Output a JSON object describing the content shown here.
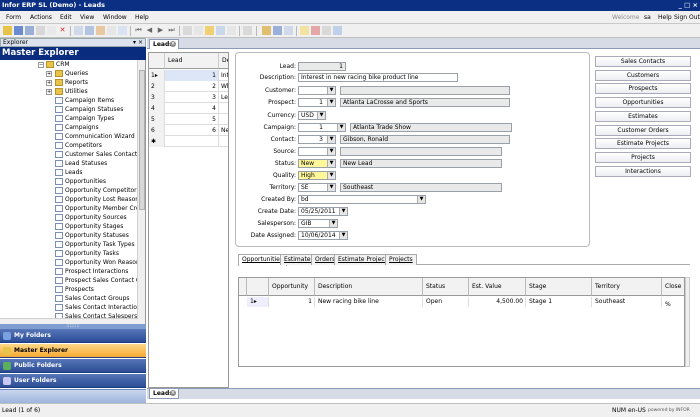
{
  "window": {
    "title": "Infor ERP SL (Demo) - Leads",
    "controls": "_ □ ×"
  },
  "menu": {
    "items": [
      "Form",
      "Actions",
      "Edit",
      "View",
      "Window",
      "Help"
    ],
    "welcome_label": "Welcome",
    "user": "sa",
    "help_label": "Help",
    "signout_label": "Sign Out"
  },
  "explorer": {
    "header": "Explorer",
    "header_controls": "▾ ×",
    "title": "Master Explorer",
    "folders": [
      {
        "label": "CRM",
        "expand": "−"
      },
      {
        "label": "Queries",
        "expand": "+"
      },
      {
        "label": "Reports",
        "expand": "+"
      },
      {
        "label": "Utilities",
        "expand": "+"
      }
    ],
    "items": [
      "Campaign Items",
      "Campaign Statuses",
      "Campaign Types",
      "Campaigns",
      "Communication Wizard",
      "Competitors",
      "Customer Sales Contact Cr",
      "Lead Statuses",
      "Leads",
      "Opportunities",
      "Opportunity Competitor Cr",
      "Opportunity Lost Reasons",
      "Opportunity Member Cross",
      "Opportunity Sources",
      "Opportunity Stages",
      "Opportunity Statuses",
      "Opportunity Task Types",
      "Opportunity Tasks",
      "Opportunity Won Reasons",
      "Prospect Interactions",
      "Prospect Sales Contact Cr",
      "Prospects",
      "Sales Contact Groups",
      "Sales Contact Interactions",
      "Sales Contact Salesperson"
    ],
    "nav": [
      "My Folders",
      "Master Explorer",
      "Public Folders",
      "User Folders"
    ],
    "splitter_grip": "::::::::"
  },
  "tabs": {
    "top": "Leads",
    "bottom": "Leads",
    "close_glyph": "×"
  },
  "grid": {
    "headers": [
      "Lead",
      "De"
    ],
    "rows": [
      {
        "marker": "1▸",
        "lead": "1",
        "desc": "Inte"
      },
      {
        "marker": "2",
        "lead": "2",
        "desc": "Wh"
      },
      {
        "marker": "3",
        "lead": "3",
        "desc": "Lea"
      },
      {
        "marker": "4",
        "lead": "4",
        "desc": ""
      },
      {
        "marker": "5",
        "lead": "5",
        "desc": ""
      },
      {
        "marker": "6",
        "lead": "6",
        "desc": "Ne"
      },
      {
        "marker": "✱",
        "lead": "",
        "desc": ""
      }
    ]
  },
  "form": {
    "lead_label": "Lead:",
    "lead": "1",
    "description_label": "Description:",
    "description": "Interest in new racing bike product line",
    "customer_label": "Customer:",
    "customer": "",
    "prospect_label": "Prospect:",
    "prospect_id": "1",
    "prospect_name": "Atlanta LaCrosse and Sports",
    "currency_label": "Currency:",
    "currency": "USD",
    "campaign_label": "Campaign:",
    "campaign_id": "1",
    "campaign_name": "Atlanta Trade Show",
    "contact_label": "Contact:",
    "contact_id": "3",
    "contact_name": "Gibson, Ronald",
    "source_label": "Source:",
    "source": "",
    "status_label": "Status:",
    "status": "New",
    "status_desc": "New Lead",
    "quality_label": "Quality:",
    "quality": "High",
    "territory_label": "Territory:",
    "territory": "SE",
    "territory_name": "Southeast",
    "created_by_label": "Created By:",
    "created_by": "bd",
    "create_date_label": "Create Date:",
    "create_date": "05/25/2011",
    "salesperson_label": "Salesperson:",
    "salesperson": "GIB",
    "date_assigned_label": "Date Assigned:",
    "date_assigned": "10/06/2014"
  },
  "side_buttons": [
    "Sales Contacts",
    "Customers",
    "Prospects",
    "Opportunities",
    "Estimates",
    "Customer Orders",
    "Estimate Projects",
    "Projects",
    "Interactions"
  ],
  "subtabs": [
    "Opportunities",
    "Estimates",
    "Orders",
    "Estimate Projects",
    "Projects"
  ],
  "subgrid": {
    "headers": [
      "Opportunity",
      "Description",
      "Status",
      "Est. Value",
      "Stage",
      "Territory",
      "Close %"
    ],
    "row": {
      "marker": "1▸",
      "opportunity": "1",
      "description": "New racing bike line",
      "status": "Open",
      "value": "4,500.00",
      "stage": "Stage 1",
      "territory": "Southeast",
      "close": ""
    }
  },
  "status": {
    "record": "Lead (1 of 6)",
    "num": "NUM",
    "locale": "en-US",
    "brand": "powered by INFOR"
  }
}
